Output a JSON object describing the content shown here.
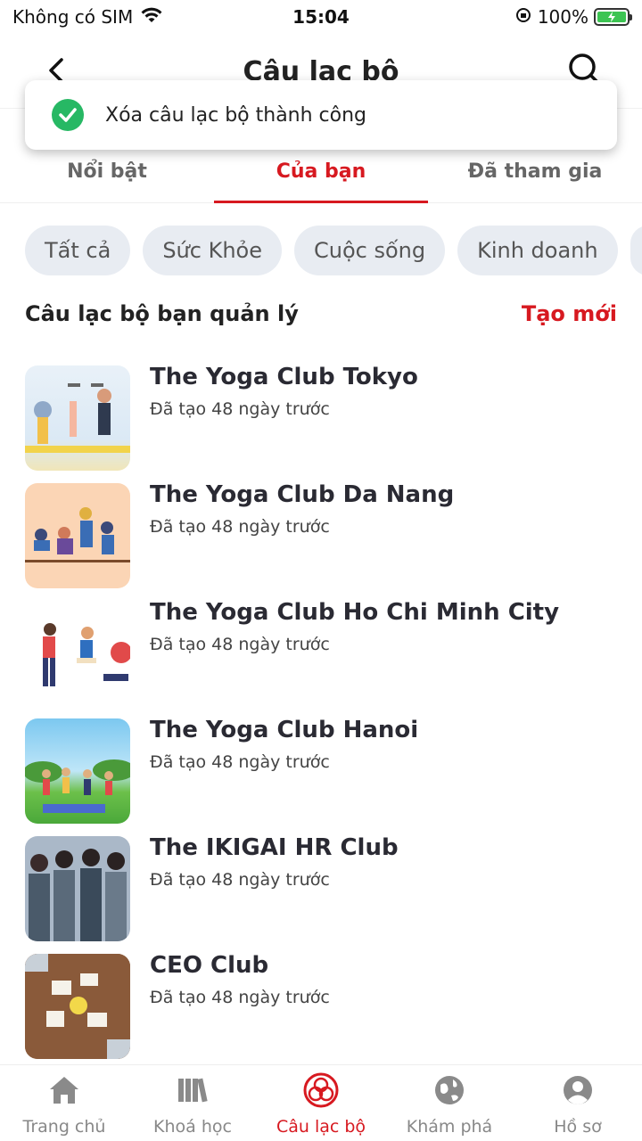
{
  "status_bar": {
    "carrier": "Không có SIM",
    "time": "15:04",
    "battery": "100%"
  },
  "header": {
    "title": "Câu lạc bộ"
  },
  "toast": {
    "message": "Xóa câu lạc bộ thành công"
  },
  "tabs": [
    {
      "label": "Nổi bật"
    },
    {
      "label": "Của bạn"
    },
    {
      "label": "Đã tham gia"
    }
  ],
  "chips": [
    {
      "label": "Tất cả"
    },
    {
      "label": "Sức Khỏe"
    },
    {
      "label": "Cuộc sống"
    },
    {
      "label": "Kinh doanh"
    }
  ],
  "section": {
    "title": "Câu lạc bộ bạn quản lý",
    "action": "Tạo mới"
  },
  "clubs": [
    {
      "name": "The Yoga Club Tokyo",
      "meta": "Đã tạo 48 ngày trước"
    },
    {
      "name": "The Yoga Club Da Nang",
      "meta": "Đã tạo 48 ngày trước"
    },
    {
      "name": "The Yoga Club Ho Chi Minh City",
      "meta": "Đã tạo 48 ngày trước"
    },
    {
      "name": "The Yoga Club Hanoi",
      "meta": "Đã tạo 48 ngày trước"
    },
    {
      "name": "The IKIGAI HR Club",
      "meta": "Đã tạo 48 ngày trước"
    },
    {
      "name": "CEO Club",
      "meta": "Đã tạo 48 ngày trước"
    }
  ],
  "bottom_nav": [
    {
      "label": "Trang chủ",
      "icon": "home-icon"
    },
    {
      "label": "Khoá học",
      "icon": "books-icon"
    },
    {
      "label": "Câu lạc bộ",
      "icon": "club-icon"
    },
    {
      "label": "Khám phá",
      "icon": "globe-icon"
    },
    {
      "label": "Hồ sơ",
      "icon": "profile-icon"
    }
  ],
  "colors": {
    "accent": "#d71920",
    "success": "#27b864",
    "chip_bg": "#e8ecf2"
  }
}
